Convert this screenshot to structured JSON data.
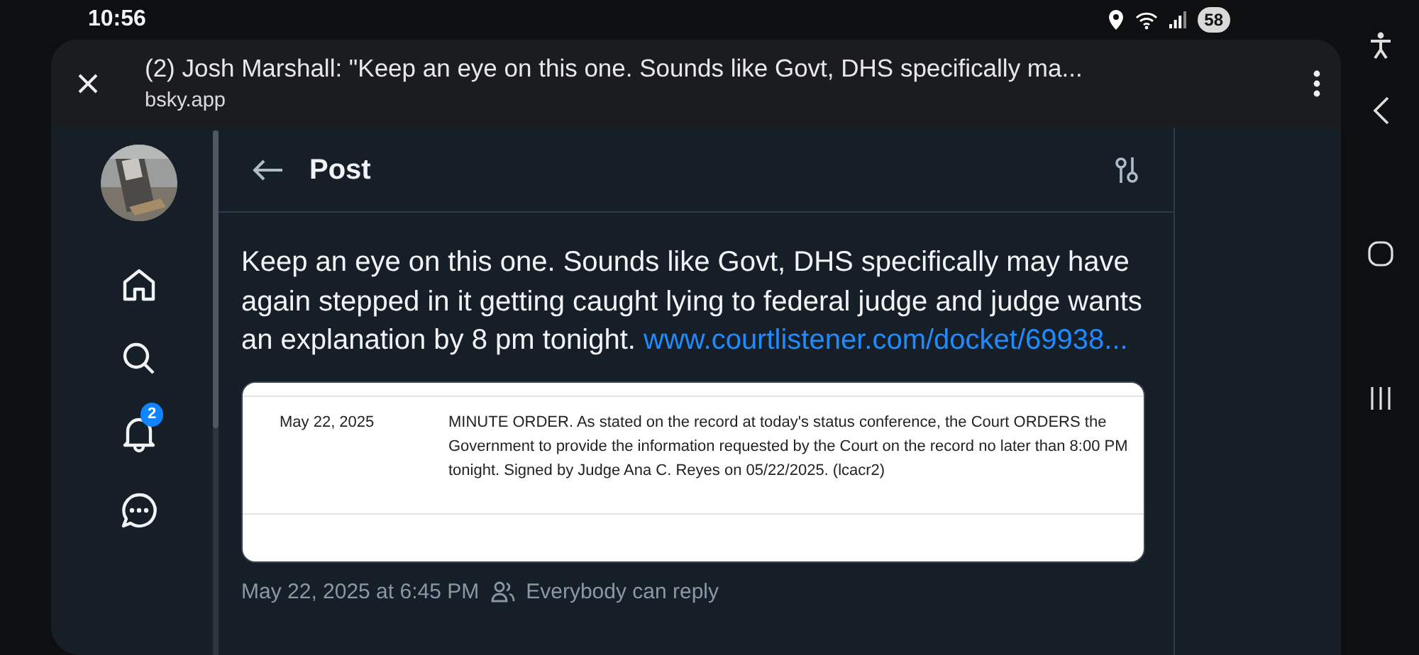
{
  "status_bar": {
    "time": "10:56",
    "battery": "58"
  },
  "browser": {
    "title": "(2) Josh Marshall: \"Keep an eye on this one. Sounds like Govt, DHS specifically ma...",
    "url": "bsky.app"
  },
  "sidebar": {
    "items": [
      {
        "kind": "avatar"
      },
      {
        "kind": "home"
      },
      {
        "kind": "search"
      },
      {
        "kind": "notifications",
        "badge": "2"
      },
      {
        "kind": "chat"
      }
    ]
  },
  "header": {
    "title": "Post"
  },
  "post": {
    "text": "Keep an eye on this one. Sounds like Govt, DHS specifically may have again stepped in it getting caught lying to federal judge and judge wants an explanation by 8 pm tonight.",
    "link": "www.courtlistener.com/docket/69938...",
    "embed": {
      "date": "May 22, 2025",
      "text": "MINUTE ORDER. As stated on the record at today's status conference, the Court ORDERS the Government to provide the information requested by the Court on the record no later than 8:00 PM tonight. Signed by Judge Ana C. Reyes on 05/22/2025. (lcacr2)"
    },
    "timestamp": "May 22, 2025 at 6:45 PM",
    "reply_setting": "Everybody can reply"
  }
}
